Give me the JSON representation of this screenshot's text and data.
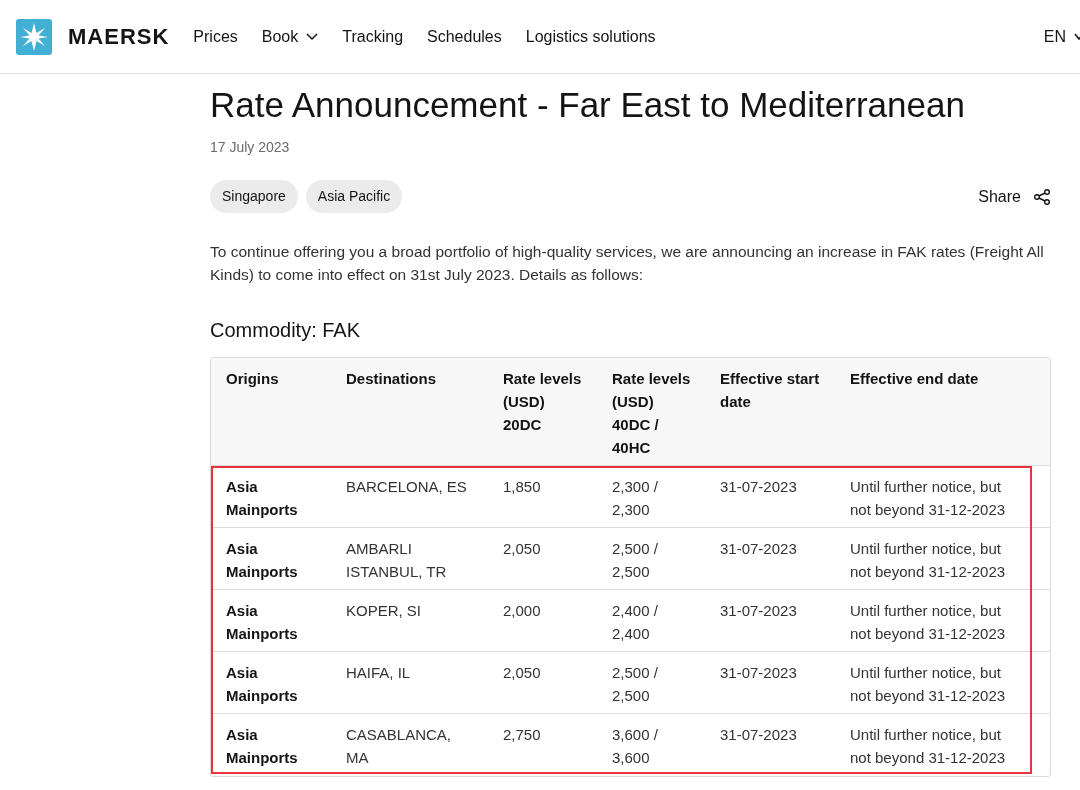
{
  "header": {
    "logo_text": "MAERSK",
    "nav": [
      {
        "label": "Prices",
        "has_menu": false
      },
      {
        "label": "Book",
        "has_menu": true
      },
      {
        "label": "Tracking",
        "has_menu": false
      },
      {
        "label": "Schedules",
        "has_menu": false
      },
      {
        "label": "Logistics solutions",
        "has_menu": false
      }
    ],
    "language": "EN"
  },
  "article": {
    "title": "Rate Announcement - Far East to Mediterranean",
    "date": "17 July 2023",
    "tags": [
      "Singapore",
      "Asia Pacific"
    ],
    "share": "Share",
    "intro": "To continue offering you a broad portfolio of high-quality services, we are announcing an increase in FAK rates (Freight All Kinds) to come into effect on 31st July 2023. Details as follows:",
    "section_title": "Commodity: FAK"
  },
  "table": {
    "highlighted": true,
    "columns": [
      "Origins",
      "Destinations",
      "Rate levels (USD) 20DC",
      "Rate levels (USD) 40DC / 40HC",
      "Effective start date",
      "Effective end date"
    ],
    "rows": [
      {
        "cells": [
          "Asia Mainports",
          "BARCELONA, ES",
          "1,850",
          "2,300 / 2,300",
          "31-07-2023",
          "Until further notice, but not beyond 31-12-2023"
        ]
      },
      {
        "cells": [
          "Asia Mainports",
          "AMBARLI ISTANBUL, TR",
          "2,050",
          "2,500 / 2,500",
          "31-07-2023",
          "Until further notice, but not beyond 31-12-2023"
        ]
      },
      {
        "cells": [
          "Asia Mainports",
          "KOPER, SI",
          "2,000",
          "2,400 / 2,400",
          "31-07-2023",
          "Until further notice, but not beyond 31-12-2023"
        ]
      },
      {
        "cells": [
          "Asia Mainports",
          "HAIFA, IL",
          "2,050",
          "2,500 / 2,500",
          "31-07-2023",
          "Until further notice, but not beyond 31-12-2023"
        ]
      },
      {
        "cells": [
          "Asia Mainports",
          "CASABLANCA, MA",
          "2,750",
          "3,600 / 3,600",
          "31-07-2023",
          "Until further notice, but not beyond 31-12-2023"
        ]
      }
    ]
  }
}
